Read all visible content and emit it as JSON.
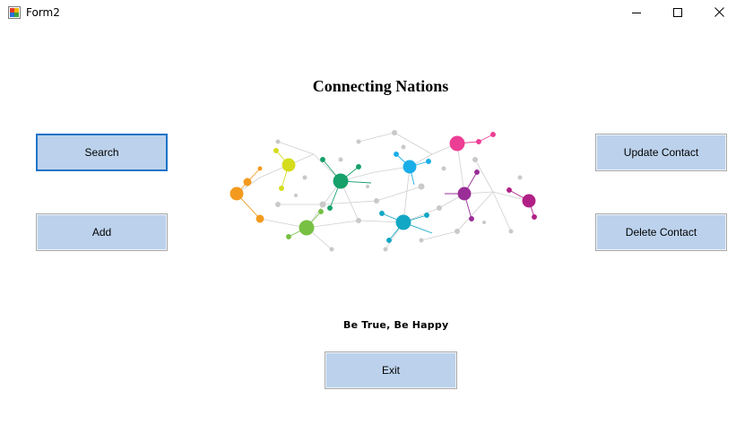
{
  "window": {
    "title": "Form2",
    "icons": {
      "app": "form-app-icon",
      "minimize": "minimize-icon",
      "maximize": "maximize-icon",
      "close": "close-icon"
    }
  },
  "form": {
    "heading": "Connecting Nations",
    "tagline": "Be True, Be Happy",
    "illustration": "network-nodes-illustration"
  },
  "buttons": {
    "search": "Search",
    "add": "Add",
    "update": "Update Contact",
    "delete": "Delete  Contact",
    "exit": "Exit"
  },
  "colors": {
    "button_fill": "#bcd2ec",
    "focus_border": "#1a73c8",
    "node_orange": "#f39a1e",
    "node_yellow": "#d4dc1c",
    "node_green": "#16a06a",
    "node_lime": "#77c043",
    "node_cyan": "#1aaee8",
    "node_teal": "#12a7c4",
    "node_pink": "#ec3e95",
    "node_purple": "#9a2d97",
    "node_magenta": "#b02086"
  }
}
